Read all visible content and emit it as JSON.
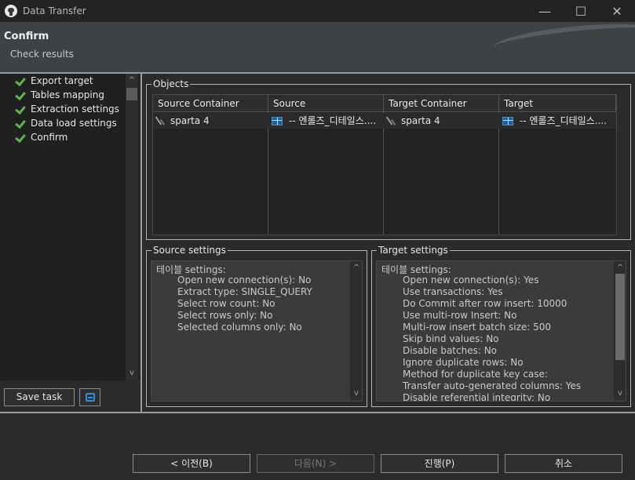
{
  "window": {
    "title": "Data Transfer",
    "minimize_glyph": "—",
    "maximize_glyph": "☐",
    "close_glyph": "✕"
  },
  "header": {
    "title": "Confirm",
    "subtitle": "Check results"
  },
  "nav": {
    "items": [
      {
        "label": "Export target"
      },
      {
        "label": "Tables mapping"
      },
      {
        "label": "Extraction settings"
      },
      {
        "label": "Data load settings"
      },
      {
        "label": "Confirm"
      }
    ],
    "up_arrow": "^",
    "down_arrow": "v",
    "save_task_label": "Save task"
  },
  "objects": {
    "legend": "Objects",
    "columns": [
      "Source Container",
      "Source",
      "Target Container",
      "Target"
    ],
    "rows": [
      {
        "source_container": "sparta 4",
        "source": "-- 엔롤즈_디테일스....",
        "target_container": "sparta 4",
        "target": "-- 엔롤즈_디테일스...."
      }
    ]
  },
  "source_settings": {
    "legend": "Source settings",
    "lines": [
      "테이블 settings:",
      "Open new connection(s): No",
      "Extract type: SINGLE_QUERY",
      "Select row count: No",
      "Select rows only: No",
      "Selected columns only: No"
    ]
  },
  "target_settings": {
    "legend": "Target settings",
    "lines": [
      "테이블 settings:",
      "Open new connection(s): Yes",
      "Use transactions: Yes",
      "Do Commit after row insert: 10000",
      "Use multi-row Insert: No",
      "Multi-row insert batch size: 500",
      "Skip bind values: No",
      "Disable batches: No",
      "Ignore duplicate rows: No",
      "Method for duplicate key case:",
      "Transfer auto-generated columns: Yes",
      "Disable referential integrity: No"
    ]
  },
  "footer": {
    "back_label": "< 이전(B)",
    "next_label": "다음(N) >",
    "proceed_label": "진행(P)",
    "cancel_label": "취소"
  },
  "colors": {
    "accent_check": "#5db64a",
    "table_icon_blue": "#3b8fd8"
  }
}
